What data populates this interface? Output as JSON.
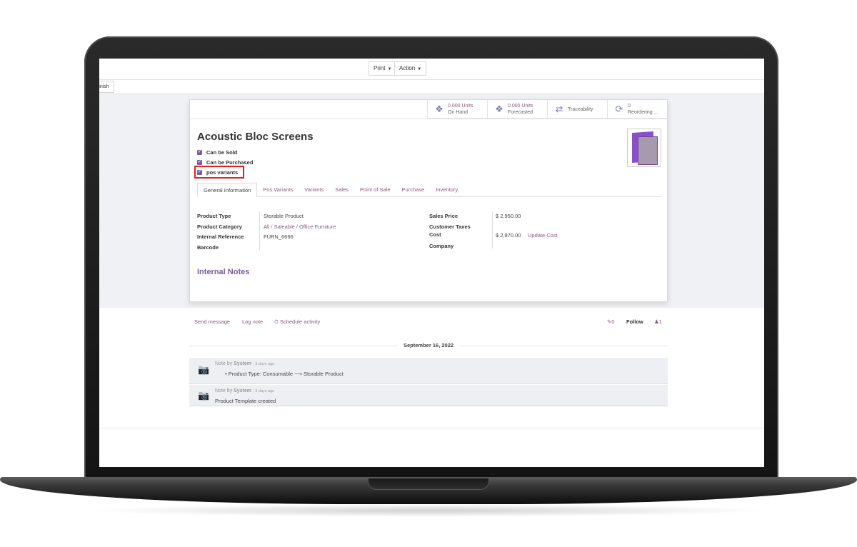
{
  "topbar": {
    "print_label": "Print",
    "action_label": "Action"
  },
  "subbar": {
    "finish_label": "Finish"
  },
  "stats": [
    {
      "num": "0.000 Units",
      "label": "On Hand",
      "icon": "cubes-icon"
    },
    {
      "num": "0.000 Units",
      "label": "Forecasted",
      "icon": "cubes-icon"
    },
    {
      "num": "",
      "label": "Traceability",
      "icon": "arrows-exchange-icon"
    },
    {
      "num": "0",
      "label": "Reordering ...",
      "icon": "refresh-icon"
    }
  ],
  "product": {
    "title": "Acoustic Bloc Screens",
    "checkboxes": [
      "Can be Sold",
      "Can be Purchased",
      "pos variants"
    ]
  },
  "tabs": [
    "General Information",
    "Pos Variants",
    "Variants",
    "Sales",
    "Point of Sale",
    "Purchase",
    "Inventory"
  ],
  "fields_left": {
    "product_type_label": "Product Type",
    "product_type_value": "Storable Product",
    "category_label": "Product Category",
    "category_value": "All / Saleable / Office Furniture",
    "ref_label": "Internal Reference",
    "ref_value": "FURN_6666",
    "barcode_label": "Barcode"
  },
  "fields_right": {
    "sales_price_label": "Sales Price",
    "sales_price_value": "$ 2,950.00",
    "taxes_label": "Customer Taxes",
    "cost_label": "Cost",
    "cost_value": "$ 2,870.00",
    "update_cost": "Update Cost",
    "company_label": "Company"
  },
  "notes_title": "Internal Notes",
  "chatter": {
    "send_message": "Send message",
    "log_note": "Log note",
    "schedule": "Schedule activity",
    "attachments": "0",
    "follow": "Follow",
    "followers": "1",
    "date": "September 16, 2022",
    "messages": [
      {
        "prefix": "Note by",
        "author": "System",
        "ago": "- 3 days ago",
        "body": "Product Type: Consumable ⟶ Storable Product"
      },
      {
        "prefix": "Note by",
        "author": "System",
        "ago": "- 3 days ago",
        "body": "Product Template created"
      }
    ]
  }
}
